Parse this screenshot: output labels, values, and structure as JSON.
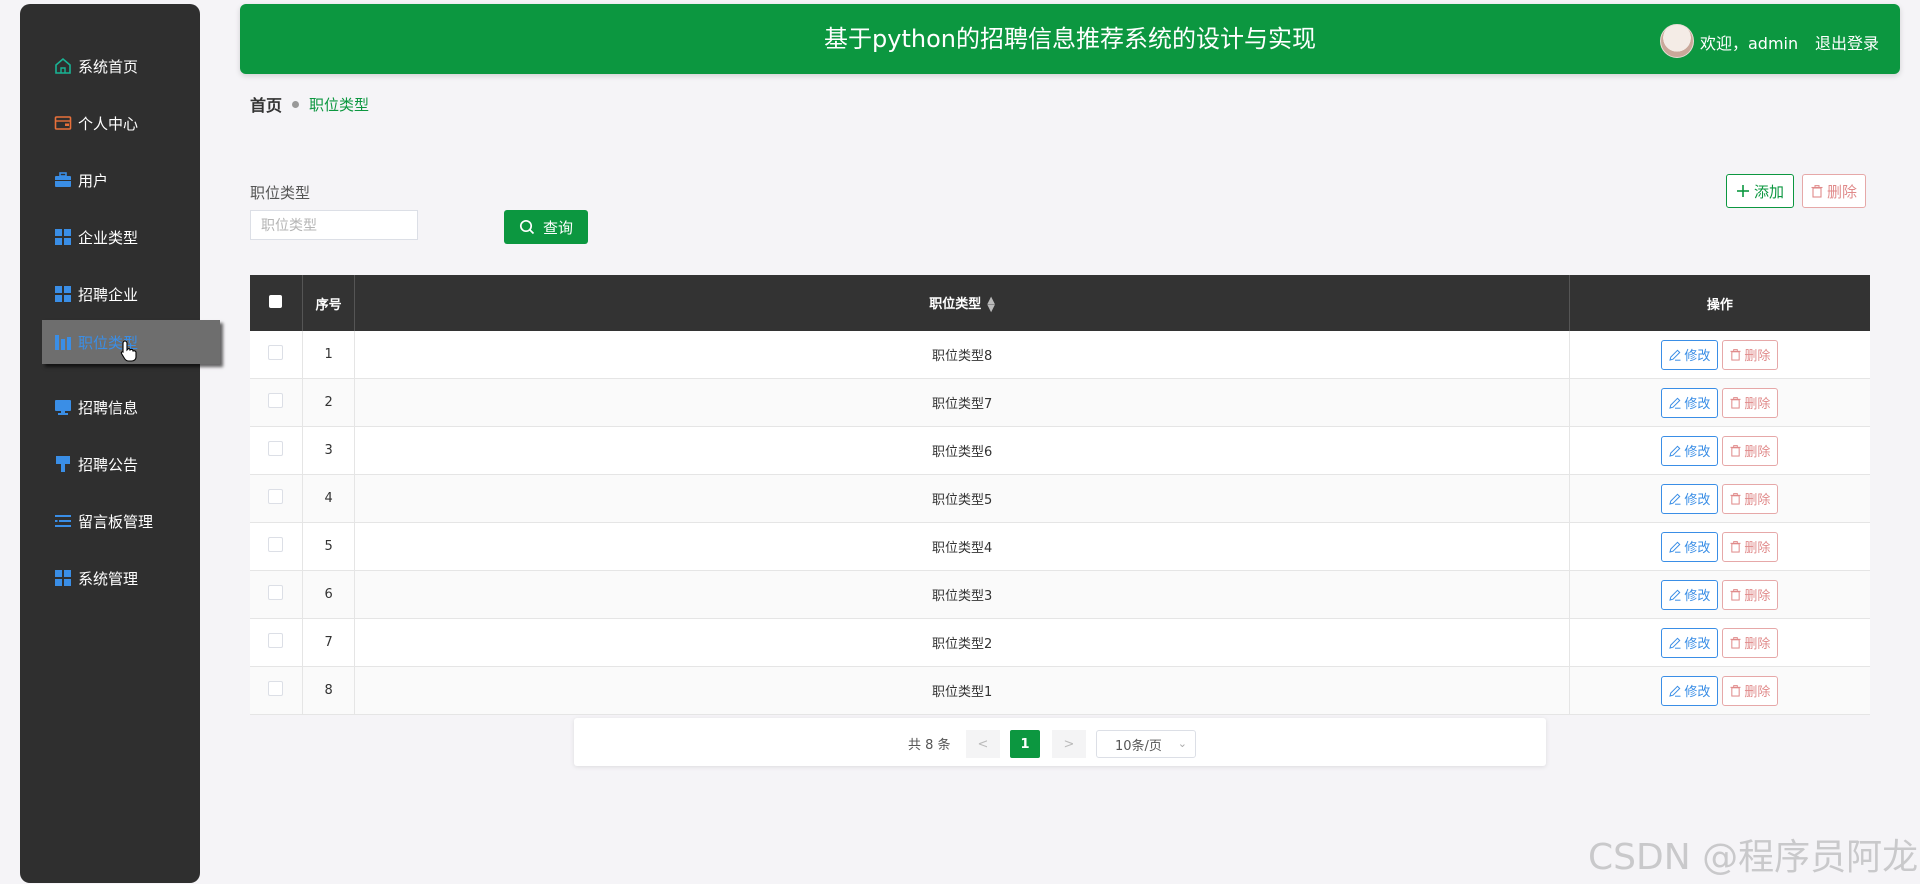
{
  "sidebar": {
    "items": [
      {
        "label": "系统首页",
        "icon": "home-icon",
        "color": "#19b394"
      },
      {
        "label": "个人中心",
        "icon": "wallet-icon",
        "color": "#e8703a"
      },
      {
        "label": "用户",
        "icon": "briefcase-icon",
        "color": "#3a8ee6"
      },
      {
        "label": "企业类型",
        "icon": "grid-icon",
        "color": "#3a8ee6"
      },
      {
        "label": "招聘企业",
        "icon": "grid-icon",
        "color": "#3a8ee6"
      },
      {
        "label": "职位类型",
        "icon": "chart-icon",
        "color": "#3a8ee6",
        "active": true
      },
      {
        "label": "招聘信息",
        "icon": "monitor-icon",
        "color": "#3a8ee6"
      },
      {
        "label": "招聘公告",
        "icon": "pin-icon",
        "color": "#3a8ee6"
      },
      {
        "label": "留言板管理",
        "icon": "list-icon",
        "color": "#3a8ee6"
      },
      {
        "label": "系统管理",
        "icon": "grid-icon",
        "color": "#3a8ee6"
      }
    ]
  },
  "header": {
    "title": "基于python的招聘信息推荐系统的设计与实现",
    "welcome": "欢迎，admin",
    "logout": "退出登录",
    "color": "#0c9740"
  },
  "breadcrumb": {
    "home": "首页",
    "current": "职位类型"
  },
  "search": {
    "label": "职位类型",
    "placeholder": "职位类型",
    "value": "",
    "query_label": "查询"
  },
  "toolbar": {
    "add_label": "添加",
    "delete_label": "删除"
  },
  "table": {
    "headers": [
      "序号",
      "职位类型",
      "操作"
    ],
    "rows": [
      {
        "idx": "1",
        "type": "职位类型8"
      },
      {
        "idx": "2",
        "type": "职位类型7"
      },
      {
        "idx": "3",
        "type": "职位类型6"
      },
      {
        "idx": "4",
        "type": "职位类型5"
      },
      {
        "idx": "5",
        "type": "职位类型4"
      },
      {
        "idx": "6",
        "type": "职位类型3"
      },
      {
        "idx": "7",
        "type": "职位类型2"
      },
      {
        "idx": "8",
        "type": "职位类型1"
      }
    ],
    "edit_label": "修改",
    "delete_label": "删除"
  },
  "pagination": {
    "total": "共 8 条",
    "prev": "<",
    "current": "1",
    "next": ">",
    "page_size": "10条/页"
  },
  "watermark": "CSDN @程序员阿龙"
}
